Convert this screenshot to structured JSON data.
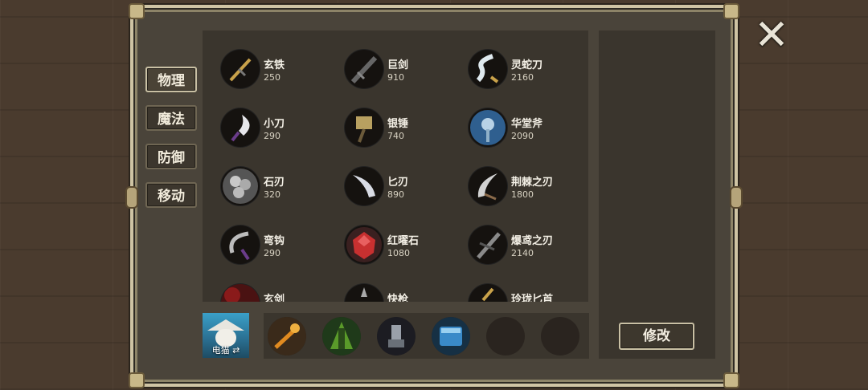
{
  "tabs": [
    {
      "label": "物理",
      "active": true
    },
    {
      "label": "魔法",
      "active": false
    },
    {
      "label": "防御",
      "active": false
    },
    {
      "label": "移动",
      "active": false
    }
  ],
  "items": [
    {
      "name": "玄铁",
      "cost": "250",
      "icon": "black-dagger-icon"
    },
    {
      "name": "巨剑",
      "cost": "910",
      "icon": "greatsword-icon"
    },
    {
      "name": "灵蛇刀",
      "cost": "2160",
      "icon": "serpent-blade-icon"
    },
    {
      "name": "小刀",
      "cost": "290",
      "icon": "small-knife-icon"
    },
    {
      "name": "银锤",
      "cost": "740",
      "icon": "silver-hammer-icon"
    },
    {
      "name": "华堂斧",
      "cost": "2090",
      "icon": "ornate-axe-icon"
    },
    {
      "name": "石刃",
      "cost": "320",
      "icon": "stone-blade-icon"
    },
    {
      "name": "匕刃",
      "cost": "890",
      "icon": "curved-dagger-icon"
    },
    {
      "name": "荆棘之刃",
      "cost": "1800",
      "icon": "thorn-blade-icon"
    },
    {
      "name": "弯钩",
      "cost": "290",
      "icon": "hook-icon"
    },
    {
      "name": "红曜石",
      "cost": "1080",
      "icon": "red-gem-icon"
    },
    {
      "name": "爆鸢之刃",
      "cost": "2140",
      "icon": "burst-blade-icon"
    },
    {
      "name": "玄剑",
      "cost": "",
      "icon": "dark-sword-icon"
    },
    {
      "name": "快枪",
      "cost": "",
      "icon": "quick-spear-icon"
    },
    {
      "name": "玲珑匕首",
      "cost": "",
      "icon": "exquisite-dagger-icon"
    }
  ],
  "hero": {
    "name": "电猫 ⇄"
  },
  "equipment": [
    {
      "icon": "fire-blade-icon"
    },
    {
      "icon": "green-cloak-icon"
    },
    {
      "icon": "steel-boots-icon"
    },
    {
      "icon": "blue-tome-icon"
    },
    {
      "icon": "empty-slot"
    },
    {
      "icon": "empty-slot"
    }
  ],
  "buttons": {
    "edit": "修改",
    "close": "✕"
  },
  "colors": {
    "panel": "#3a352d",
    "frame": "#cfc4a4",
    "text": "#f4f0e6"
  }
}
